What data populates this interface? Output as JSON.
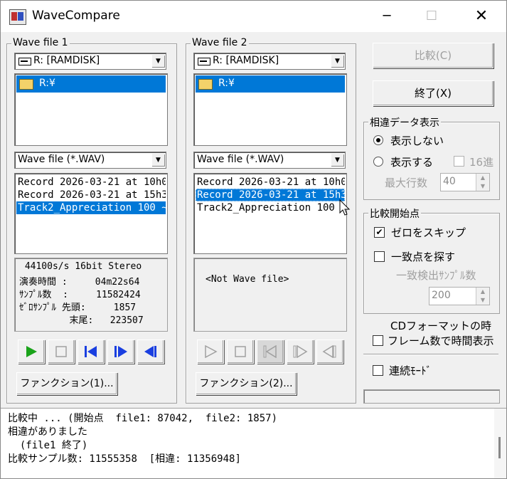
{
  "window": {
    "title": "WaveCompare",
    "minimize": "─",
    "maximize": "☐",
    "close": "✕"
  },
  "panel1": {
    "title": "Wave file 1",
    "drive": "R: [RAMDISK]",
    "dir": "R:¥",
    "filter": "Wave file (*.WAV)",
    "files": [
      "Record 2026-03-21 at 10h0",
      "Record 2026-03-21 at 15h3",
      "Track2_Appreciation 100 ~"
    ],
    "selected_index": 2,
    "info": {
      "line1": " 44100s/s 16bit Stereo",
      "line2": "演奏時間 :     04m22s64",
      "line3": "ｻﾝﾌﾟﾙ数  :     11582424",
      "line4": "ｾﾞﾛｻﾝﾌﾟﾙ 先頭:     1857",
      "line5": "         末尾:   223507"
    },
    "func_button": "ファンクション(1)..."
  },
  "panel2": {
    "title": "Wave file 2",
    "drive": "R: [RAMDISK]",
    "dir": "R:¥",
    "filter": "Wave file (*.WAV)",
    "files": [
      "Record 2026-03-21 at 10h0",
      "Record 2026-03-21 at 15h3",
      "Track2_Appreciation 100 ~"
    ],
    "selected_index": 1,
    "info": {
      "message": "<Not Wave file>"
    },
    "func_button": "ファンクション(2)..."
  },
  "right": {
    "compare_button": "比較(C)",
    "exit_button": "終了(X)",
    "diff_group": {
      "title": "相違データ表示",
      "opt_hide": "表示しない",
      "opt_show": "表示する",
      "hex": "16進",
      "max_lines_label": "最大行数",
      "max_lines_value": "40"
    },
    "start_group": {
      "title": "比較開始点",
      "skip_zero": "ゼロをスキップ",
      "find_match": "一致点を探す",
      "match_samples_label": "一致検出ｻﾝﾌﾟﾙ数",
      "match_samples_value": "200"
    },
    "cd_format_label": "CDフォーマットの時",
    "frame_time": "フレーム数で時間表示",
    "continuous": "連続ﾓｰﾄﾞ"
  },
  "log": {
    "line1": "比較中 ... (開始点  file1: 87042,  file2: 1857)",
    "line2": "相違がありました",
    "line3": "  (file1 終了)",
    "line4": "比較サンプル数: 11555358  [相違: 11356948]"
  },
  "colors": {
    "selection": "#0078d7",
    "play_green": "#1aa31a",
    "seek_blue": "#1a3fe0",
    "disabled": "#a0a0a0"
  }
}
